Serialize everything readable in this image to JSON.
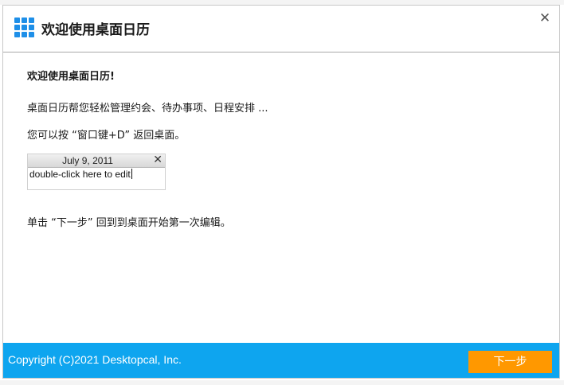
{
  "header": {
    "title": "欢迎使用桌面日历",
    "logo_icon": "app-grid-icon",
    "close_label": "✕",
    "logo_color": "#1e8fe8"
  },
  "content": {
    "welcome": "欢迎使用桌面日历!",
    "description": "桌面日历帮您轻松管理约会、待办事项、日程安排 ...",
    "tip": "您可以按 “窗口键+D” 返回桌面。",
    "note_widget": {
      "date": "July 9, 2011",
      "close_label": "✕",
      "body": "double-click here to edit"
    },
    "next_tip": "单击 “下一步” 回到到桌面开始第一次编辑。"
  },
  "footer": {
    "copyright": "Copyright (C)2021 Desktopcal, Inc.",
    "next_button": "下一步",
    "background_color": "#0ea5ef",
    "button_color": "#ff9800"
  }
}
